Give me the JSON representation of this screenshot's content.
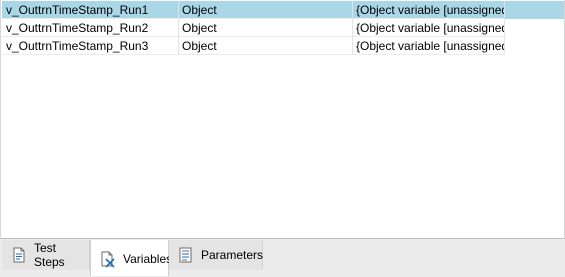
{
  "variables_grid": {
    "rows": [
      {
        "name": "v_OuttrnTimeStamp_Run1",
        "type": "Object",
        "value": "{Object variable [unassigned]}",
        "selected": true
      },
      {
        "name": "v_OuttrnTimeStamp_Run2",
        "type": "Object",
        "value": "{Object variable [unassigned]}",
        "selected": false
      },
      {
        "name": "v_OuttrnTimeStamp_Run3",
        "type": "Object",
        "value": "{Object variable [unassigned]}",
        "selected": false
      }
    ]
  },
  "tabs": {
    "test_steps": {
      "label": "Test Steps",
      "icon": "document-icon"
    },
    "variables": {
      "label": "Variables",
      "icon": "variable-x-icon",
      "active": true
    },
    "parameters": {
      "label": "Parameters",
      "icon": "parameters-list-icon"
    }
  },
  "colors": {
    "selected_row": "#a9d7e8",
    "tabbar_bg": "#ececec",
    "icon_blue": "#1f6fb5"
  }
}
